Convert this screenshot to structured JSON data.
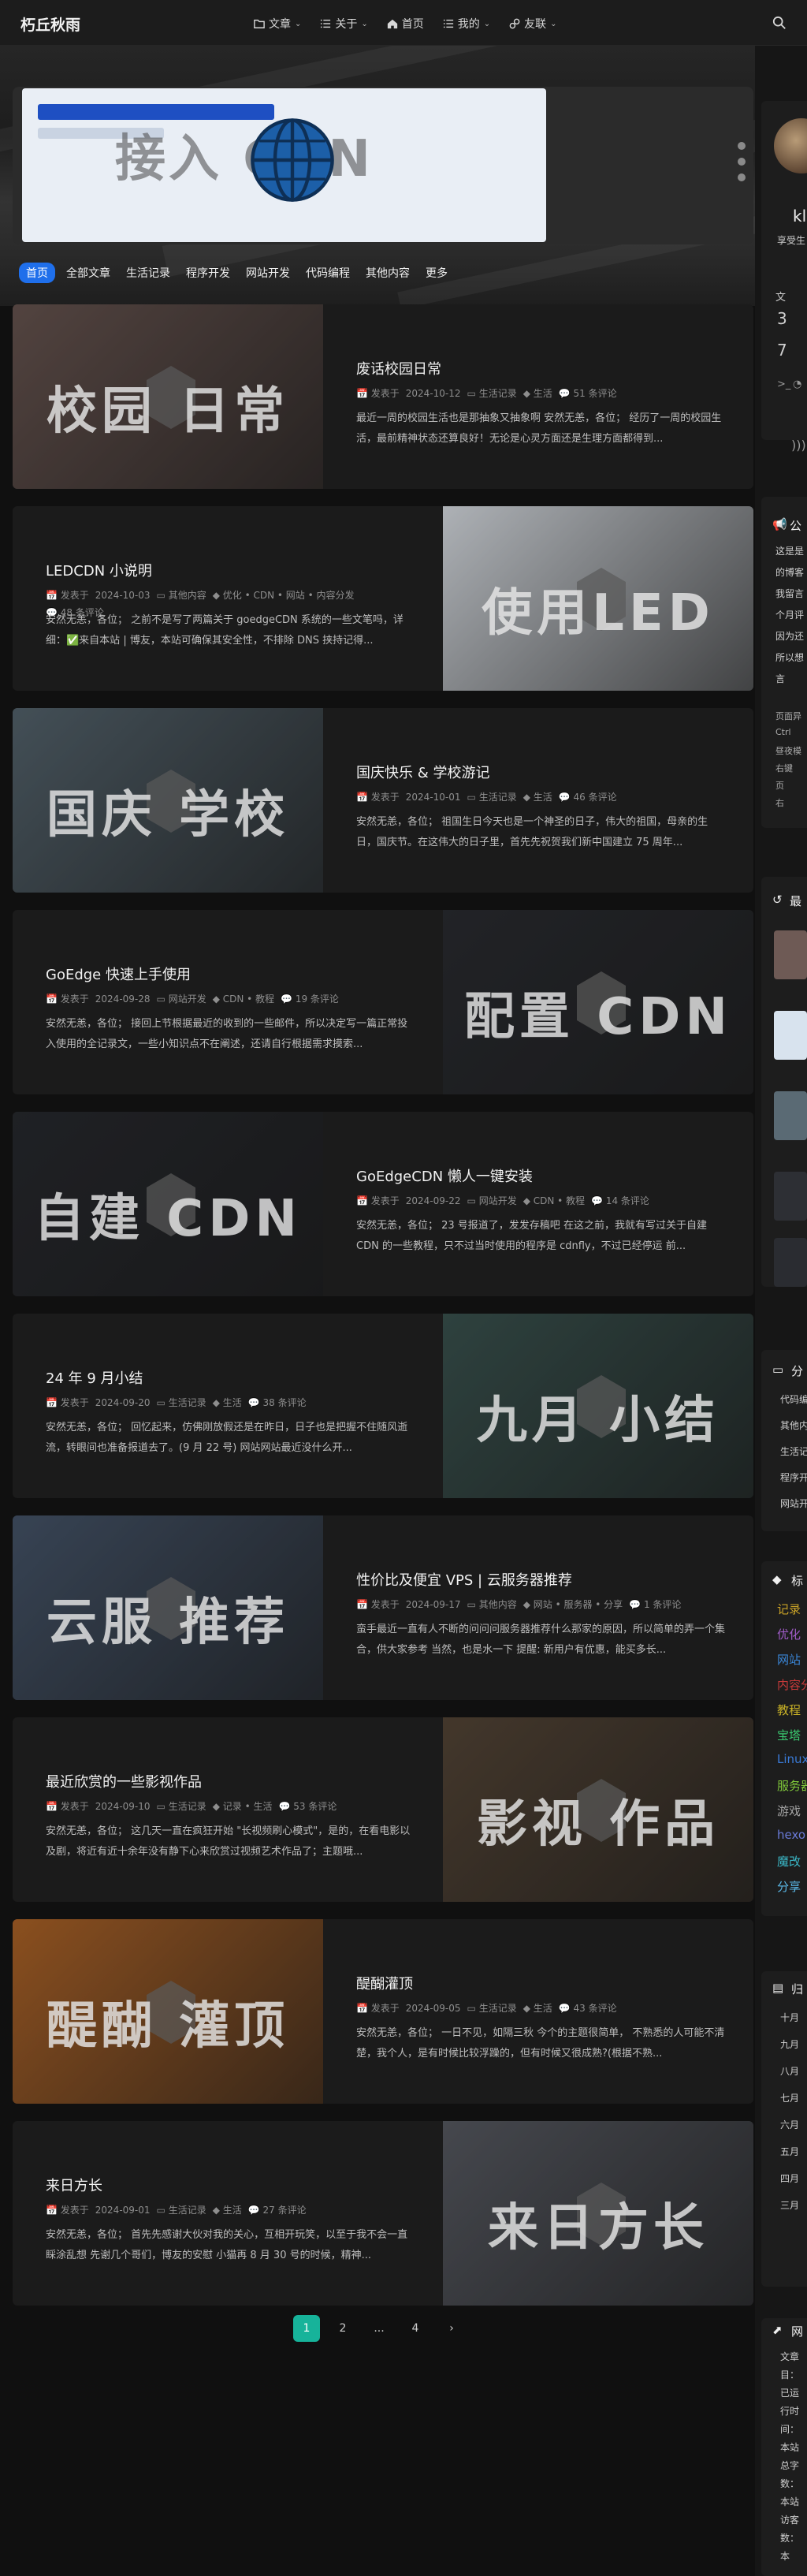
{
  "site": {
    "title": "朽丘秋雨"
  },
  "nav": {
    "items": [
      {
        "label": "文章",
        "icon": "folder-icon",
        "caret": true
      },
      {
        "label": "关于",
        "icon": "list-icon",
        "caret": true
      },
      {
        "label": "首页",
        "icon": "home-icon",
        "caret": false
      },
      {
        "label": "我的",
        "icon": "list-icon",
        "caret": true
      },
      {
        "label": "友联",
        "icon": "link-icon",
        "caret": true
      }
    ],
    "search_icon": "search-icon"
  },
  "banner": {
    "title": "接入 CDN"
  },
  "categories": [
    "首页",
    "全部文章",
    "生活记录",
    "程序开发",
    "网站开发",
    "代码编程",
    "其他内容",
    "更多"
  ],
  "posts": [
    {
      "title": "废话校园日常",
      "date": "2024-10-12",
      "category": "生活记录",
      "tags": "生活",
      "comments": "51 条评论",
      "excerpt": "最近一周的校园生活也是那抽象又抽象啊 安然无恙，各位； 经历了一周的校园生活，最前精神状态还算良好！无论是心灵方面还是生理方面都得到...",
      "thumb_text": "校园  日常",
      "thumb_color": "#6e5a55"
    },
    {
      "title": "LEDCDN 小说明",
      "date": "2024-10-03",
      "category": "其他内容",
      "tags": "优化 • CDN • 网站 • 内容分发",
      "comments": "48 条评论",
      "excerpt": "安然无恙，各位； 之前不是写了两篇关于 goedgeCDN 系统的一些文笔吗，详细：✅来自本站 | 博友，本站可确保其安全性，不排除 DNS 挟持记得...",
      "thumb_text": "使用LED",
      "thumb_color": "#e8edf3"
    },
    {
      "title": "国庆快乐 & 学校游记",
      "date": "2024-10-01",
      "category": "生活记录",
      "tags": "生活",
      "comments": "46 条评论",
      "excerpt": "安然无恙，各位； 祖国生日今天也是一个神圣的日子，伟大的祖国，母亲的生日，国庆节。在这伟大的日子里，首先先祝贺我们新中国建立 75 周年...",
      "thumb_text": "国庆  学校",
      "thumb_color": "#5a6a74"
    },
    {
      "title": "GoEdge 快速上手使用",
      "date": "2024-09-28",
      "category": "网站开发",
      "tags": "CDN • 教程",
      "comments": "19 条评论",
      "excerpt": "安然无恙，各位； 接回上节根据最近的收到的一些邮件，所以决定写一篇正常投入使用的全记录文，一些小知识点不在阐述，还请自行根据需求摸索...",
      "thumb_text": "配置  CDN",
      "thumb_color": "#2d2f34"
    },
    {
      "title": "GoEdgeCDN 懒人一键安装",
      "date": "2024-09-22",
      "category": "网站开发",
      "tags": "CDN • 教程",
      "comments": "14 条评论",
      "excerpt": "安然无恙，各位； 23 号报道了，发发存稿吧 在这之前，我就有写过关于自建 CDN 的一些教程，只不过当时使用的程序是 cdnfly，不过已经停运 前...",
      "thumb_text": "自建  CDN",
      "thumb_color": "#2a2c31"
    },
    {
      "title": "24 年 9 月小结",
      "date": "2024-09-20",
      "category": "生活记录",
      "tags": "生活",
      "comments": "38 条评论",
      "excerpt": "安然无恙，各位； 回忆起来，仿佛刚放假还是在昨日，日子也是把握不住随风逝流，转眼间也准备报道去了。(9 月 22 号) 网站网站最近没什么开...",
      "thumb_text": "九月  小结",
      "thumb_color": "#3e5854"
    },
    {
      "title": "性价比及便宜 VPS | 云服务器推荐",
      "date": "2024-09-17",
      "category": "其他内容",
      "tags": "网站 • 服务器 • 分享",
      "comments": "1 条评论",
      "excerpt": "蛮手最近一直有人不断的问问问服务器推荐什么那家的原因，所以简单的弄一个集合，供大家参考 当然，也是水一下 提醒: 新用户有优惠，能买多长...",
      "thumb_text": "云服  推荐",
      "thumb_color": "#4a5a70"
    },
    {
      "title": "最近欣赏的一些影视作品",
      "date": "2024-09-10",
      "category": "生活记录",
      "tags": "记录 • 生活",
      "comments": "53 条评论",
      "excerpt": "安然无恙，各位； 这几天一直在疯狂开始 \"长视频刷心模式\"，是的，在看电影以及剧，将近有近十余年没有静下心来欣赏过视频艺术作品了；主题哦...",
      "thumb_text": "影视  作品",
      "thumb_color": "#5a4a3a"
    },
    {
      "title": "醍醐灌顶",
      "date": "2024-09-05",
      "category": "生活记录",
      "tags": "生活",
      "comments": "43 条评论",
      "excerpt": "安然无恙，各位； 一日不见，如隔三秋 今个的主题很简单， 不熟悉的人可能不清楚，我个人，是有时候比较浮躁的，但有时候又很成熟?(根据不熟...",
      "thumb_text": "醍醐  灌顶",
      "thumb_color": "#b96a2a"
    },
    {
      "title": "来日方长",
      "date": "2024-09-01",
      "category": "生活记录",
      "tags": "生活",
      "comments": "27 条评论",
      "excerpt": "安然无恙，各位； 首先先感谢大伙对我的关心，互相开玩笑，以至于我不会一直睬涂乱想 先谢几个哥们，博友的安慰 小猫再 8 月 30 号的时候，精神...",
      "thumb_text": "来日方长",
      "thumb_color": "#5d6068"
    }
  ],
  "meta_labels": {
    "published": "发表于"
  },
  "pager": {
    "pages": [
      "1",
      "2",
      "...",
      "4"
    ],
    "next": "›"
  },
  "sidebar": {
    "profile_name": "kl",
    "profile_desc": "享受生",
    "stats": [
      {
        "label": "文",
        "value": "3"
      },
      {
        "value": "7"
      }
    ],
    "notice_title": "公",
    "notice_lines": [
      "这是是",
      "的博客",
      "我留言",
      "个月评",
      "因为还",
      "所以想",
      "言"
    ],
    "notice_extra": [
      "页面异",
      "Ctrl",
      "昼夜模",
      "右键",
      "页",
      "右"
    ],
    "recent_title": "最",
    "cats_title": "分",
    "cat_items": [
      "代码编",
      "其他内",
      "生活记",
      "程序开",
      "网站开"
    ],
    "tags_title": "标",
    "tag_items": [
      {
        "label": "记录",
        "color": "#c9a227"
      },
      {
        "label": "优化",
        "color": "#a05cc8"
      },
      {
        "label": "网站",
        "color": "#3a86d8"
      },
      {
        "label": "内容分",
        "color": "#c93a3a"
      },
      {
        "label": "教程",
        "color": "#c9b227"
      },
      {
        "label": "宝塔",
        "color": "#3ac86f"
      },
      {
        "label": "Linux",
        "color": "#3a7bd8"
      },
      {
        "label": "服务器",
        "color": "#7fc83a"
      },
      {
        "label": "游戏",
        "color": "#a3a3a3"
      },
      {
        "label": "hexo",
        "color": "#6a7bd8"
      },
      {
        "label": "魔改",
        "color": "#3ab8c8"
      },
      {
        "label": "分享",
        "color": "#5ab8e8"
      }
    ],
    "archive_title": "归",
    "archive_items": [
      "十月",
      "九月",
      "八月",
      "七月",
      "六月",
      "五月",
      "四月",
      "三月"
    ],
    "site_title": "网",
    "site_items": [
      "文章",
      "目：",
      "已运",
      "行时",
      "间：",
      "本站",
      "总字",
      "数：",
      "本站",
      "访客",
      "数：",
      "本"
    ]
  }
}
